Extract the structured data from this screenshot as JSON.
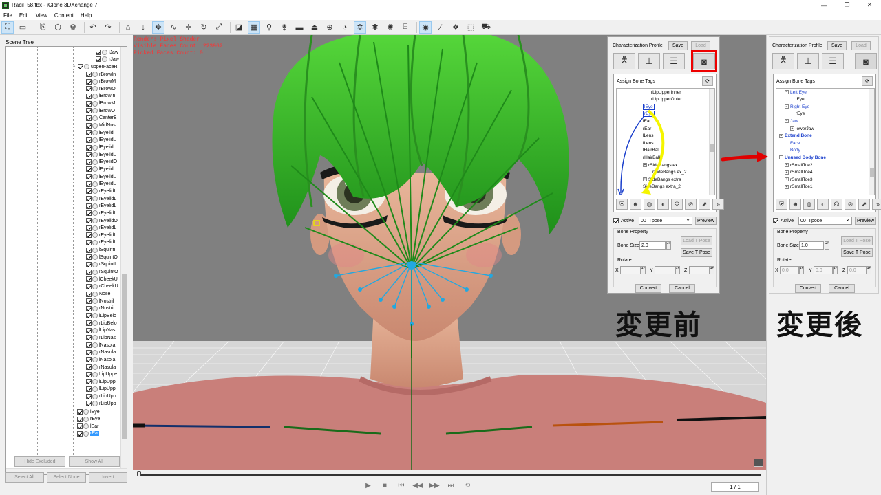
{
  "window": {
    "title": "Racil_58.fbx - iClone 3DXchange 7",
    "min": "—",
    "max": "❐",
    "close": "✕"
  },
  "menu": [
    "File",
    "Edit",
    "View",
    "Content",
    "Help"
  ],
  "scene": {
    "header": "Scene Tree",
    "top_items": [
      "lJaw",
      "rJaw"
    ],
    "group_label": "upperFaceR",
    "items": [
      "rBrowIn",
      "rBrowM",
      "rBrowO",
      "lBrowIn",
      "lBrowM",
      "lBrowO",
      "CenterB",
      "MidNos",
      "lEyelidI",
      "lEyelidL",
      "lEyelidL",
      "lEyelidL",
      "lEyelidO",
      "lEyelidL",
      "lEyelidL",
      "lEyelidL",
      "rEyelidI",
      "rEyelidL",
      "rEyelidL",
      "rEyelidL",
      "rEyelidO",
      "rEyelidL",
      "rEyelidL",
      "rEyelidL",
      "lSquintI",
      "lSquintO",
      "rSquintI",
      "rSquintO",
      "lCheekU",
      "rCheekU",
      "Nose",
      "lNostril",
      "rNostril",
      "lLipBelo",
      "rLipBelo",
      "lLipNas",
      "rLipNas",
      "lNasola",
      "rNasola",
      "lNasola",
      "rNasola",
      "LipUppe",
      "lLipUpp",
      "lLipUpp",
      "rLipUpp",
      "rLipUpp"
    ],
    "bottom_items": [
      "lEye",
      "rEye",
      "lEar",
      "rEar"
    ],
    "buttons": {
      "hide_excluded": "Hide Excluded",
      "show_all": "Show All",
      "select_all": "Select All",
      "select_none": "Select None",
      "invert": "Invert"
    }
  },
  "viewport": {
    "info": [
      "Render: Pixel Shader",
      "Visible Faces Count: 223962",
      "Picked Faces Count: 0"
    ]
  },
  "timeline": {
    "frame": "1 / 1",
    "controls": [
      "▶",
      "■",
      "⏮",
      "◀◀",
      "▶▶",
      "⏭",
      "⟲"
    ]
  },
  "before_panel": {
    "profile_label": "Characterization Profile",
    "save": "Save",
    "load": "Load",
    "assign_bone_tags": "Assign Bone Tags",
    "tree": [
      "rLipUpperInner",
      "rLipUpperOuter",
      "lEye",
      "rEye",
      "lEar",
      "rEar",
      "lLens",
      "lLens",
      "lHairBall",
      "rHairBall",
      "rSideBangs ex",
      "rSideBangs ex_2",
      "SideBangs extra",
      "SideBangs extra_2"
    ],
    "active_label": "Active",
    "pose": "00_Tpose",
    "preview": "Preview",
    "bone_property": "Bone Property",
    "bone_size_label": "Bone Size",
    "bone_size": "2.0",
    "load_t_pose": "Load T Pose",
    "save_t_pose": "Save T Pose",
    "rotate": "Rotate",
    "x": "X",
    "y": "Y",
    "z": "Z",
    "convert": "Convert",
    "cancel": "Cancel",
    "caption": "変更前"
  },
  "after_panel": {
    "profile_label": "Characterization Profile",
    "save": "Save",
    "load": "Load",
    "assign_bone_tags": "Assign Bone Tags",
    "tree": [
      {
        "t": "Left Eye",
        "c": "blue",
        "i": 1,
        "e": "−"
      },
      {
        "t": "lEye",
        "c": "",
        "i": 3,
        "e": ""
      },
      {
        "t": "Right Eye",
        "c": "blue",
        "i": 1,
        "e": "−"
      },
      {
        "t": "rEye",
        "c": "",
        "i": 3,
        "e": ""
      },
      {
        "t": "Jaw",
        "c": "blue",
        "i": 1,
        "e": "−"
      },
      {
        "t": "lowerJaw",
        "c": "",
        "i": 2,
        "e": "+"
      },
      {
        "t": "Extend Bone",
        "c": "bold",
        "i": 0,
        "e": "−"
      },
      {
        "t": "Face",
        "c": "blue",
        "i": 2,
        "e": ""
      },
      {
        "t": "Body",
        "c": "blue",
        "i": 2,
        "e": ""
      },
      {
        "t": "Unused Body Bone",
        "c": "bold",
        "i": 0,
        "e": "−"
      },
      {
        "t": "rSmallToe2",
        "c": "",
        "i": 1,
        "e": "+"
      },
      {
        "t": "rSmallToe4",
        "c": "",
        "i": 1,
        "e": "+"
      },
      {
        "t": "rSmallToe3",
        "c": "",
        "i": 1,
        "e": "+"
      },
      {
        "t": "rSmallToe1",
        "c": "",
        "i": 1,
        "e": "+"
      }
    ],
    "active_label": "Active",
    "pose": "00_Tpose",
    "preview": "Preview",
    "bone_property": "Bone Property",
    "bone_size_label": "Bone Size",
    "bone_size": "1.0",
    "load_t_pose": "Load T Pose",
    "save_t_pose": "Save T Pose",
    "rotate": "Rotate",
    "x": "X",
    "y": "Y",
    "z": "Z",
    "xv": "0.0",
    "yv": "0.0",
    "zv": "0.0",
    "convert": "Convert",
    "cancel": "Cancel",
    "caption": "変更後"
  },
  "colors": {
    "hair": "#3fbf2a",
    "bone_cyan": "#22a8e0",
    "annotation_red": "#e00000",
    "annotation_yellow": "#f5f500",
    "annotation_blue": "#1a3fcc"
  }
}
